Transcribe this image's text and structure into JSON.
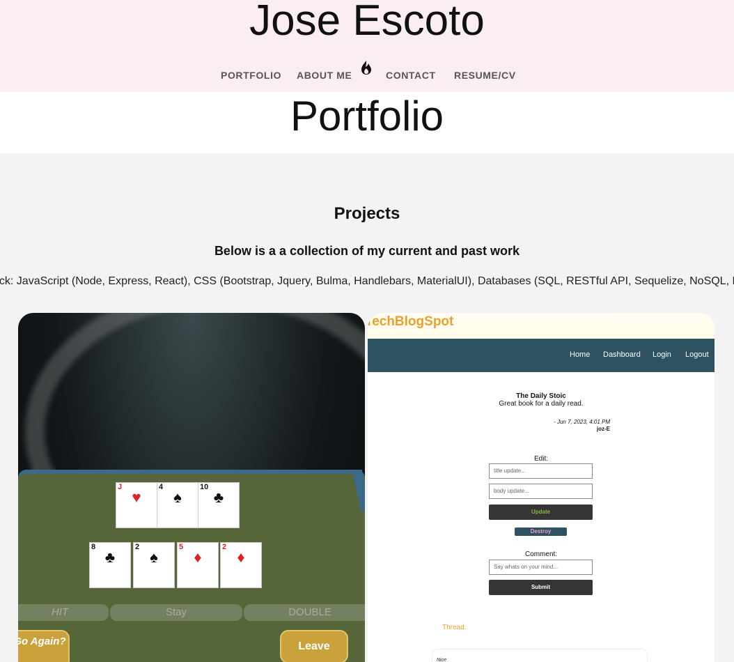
{
  "header": {
    "name": "Jose Escoto",
    "nav": {
      "portfolio": "PORTFOLIO",
      "about": "ABOUT ME",
      "contact": "CONTACT",
      "resume": "RESUME/CV"
    }
  },
  "banner": {
    "title": "Portfolio"
  },
  "projects": {
    "title": "Projects",
    "subtitle": "Below is a a collection of my current and past work",
    "stack": "ack: JavaScript (Node, Express, React), CSS (Bootstrap, Jquery, Bulma, Handlebars, MaterialUI), Databases (SQL, RESTful API, Sequelize, NoSQL, Mo"
  },
  "blackjack": {
    "dealer_cards": [
      {
        "rank": "J",
        "suit": "♥",
        "color": "red"
      },
      {
        "rank": "4",
        "suit": "♠",
        "color": "blk"
      },
      {
        "rank": "10",
        "suit": "♣",
        "color": "blk"
      }
    ],
    "player_cards": [
      {
        "rank": "8",
        "suit": "♣",
        "color": "blk"
      },
      {
        "rank": "2",
        "suit": "♠",
        "color": "blk"
      },
      {
        "rank": "5",
        "suit": "♦",
        "color": "red"
      },
      {
        "rank": "2",
        "suit": "♦",
        "color": "red"
      }
    ],
    "buttons": {
      "hit": "HIT",
      "stay": "Stay",
      "double": "DOUBLE",
      "go_again": "Go Again?",
      "leave": "Leave"
    }
  },
  "blog": {
    "brand": "TechBlogSpot",
    "nav": {
      "home": "Home",
      "dashboard": "Dashboard",
      "login": "Login",
      "logout": "Logout"
    },
    "post": {
      "title": "The Daily Stoic",
      "body": "Great book for a daily read.",
      "date": "- Jun 7, 2023, 4:01 PM",
      "author": "joz-E"
    },
    "edit_label": "Edit:",
    "title_placeholder": "title update...",
    "body_placeholder": "body update...",
    "update": "Update",
    "destroy": "Destroy",
    "comment_label": "Comment:",
    "comment_placeholder": "Say whats on your mind...",
    "submit": "Submit",
    "thread_label": "Thread:",
    "thread_item": "Nice"
  },
  "colors": {
    "header_bg": "#fbeef2",
    "page_bg": "#f3f3f3",
    "blog_nav": "#2e5261",
    "blog_accent": "#e8a12b",
    "table_green": "#576638",
    "gold": "#c9a23c"
  },
  "icons": {
    "logo": "flame-icon"
  }
}
